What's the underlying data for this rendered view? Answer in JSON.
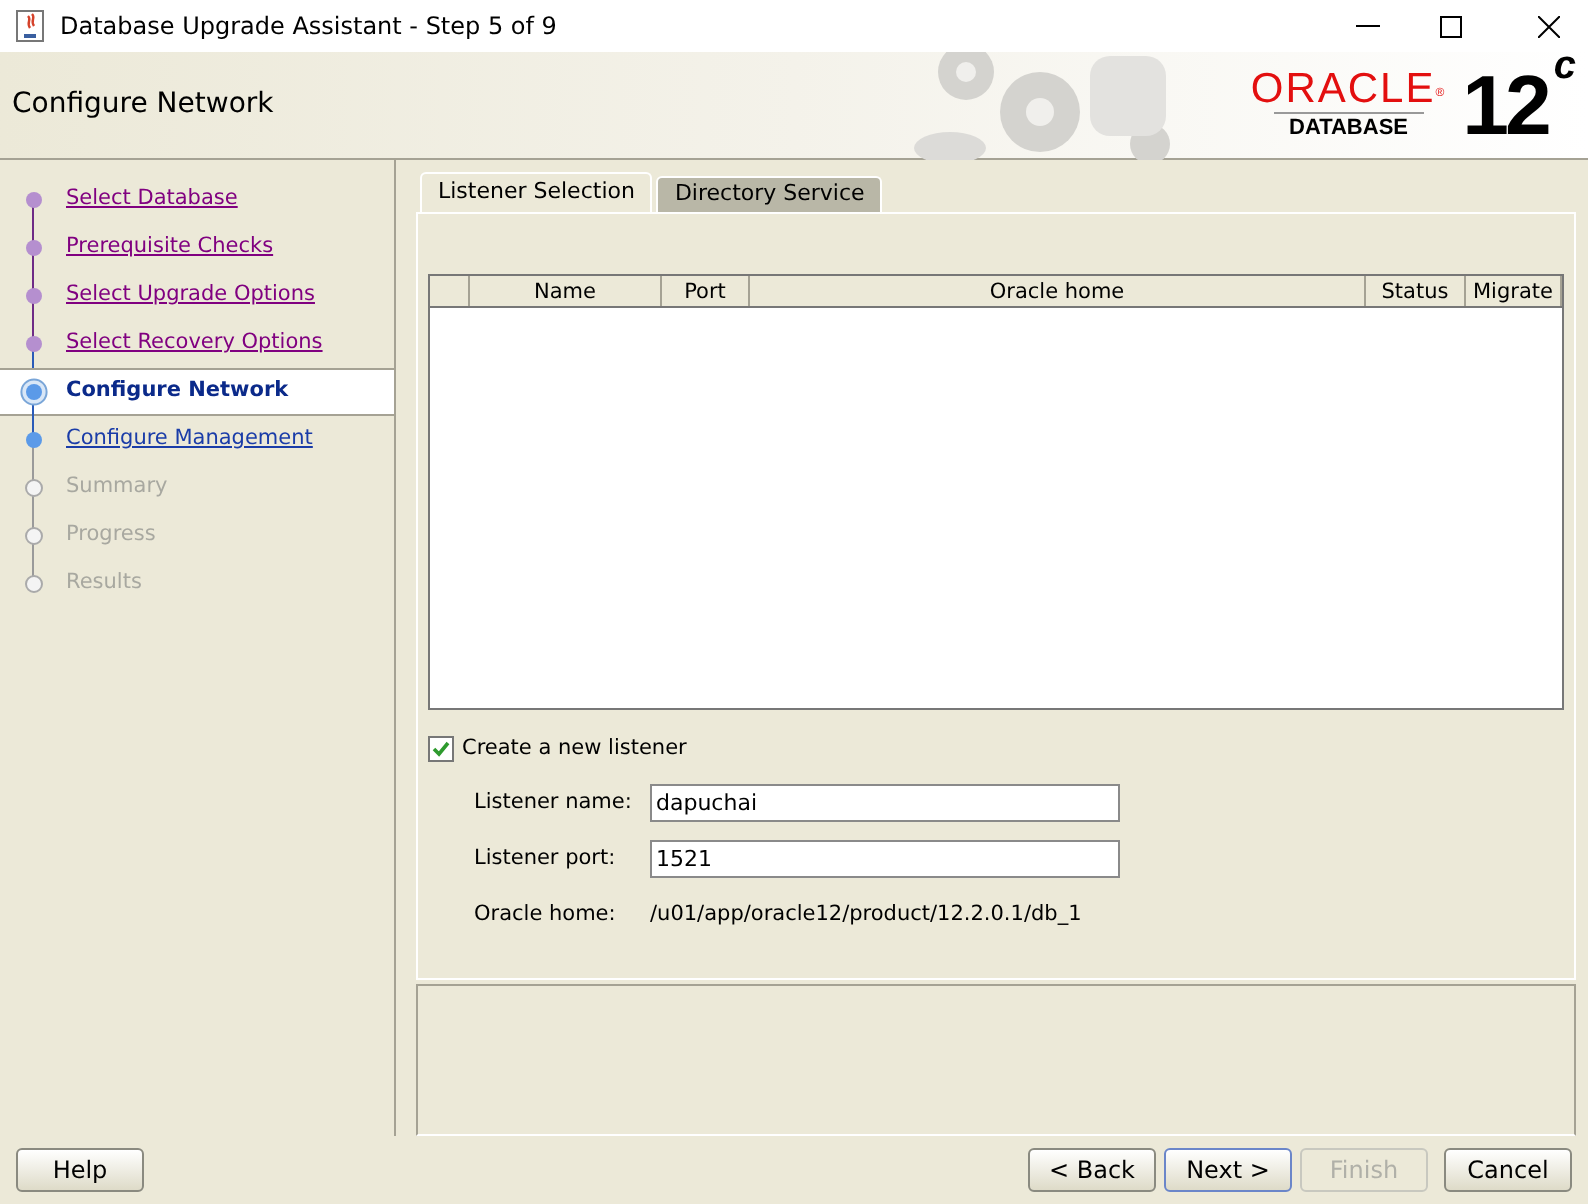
{
  "window": {
    "title": "Database Upgrade Assistant - Step 5 of 9"
  },
  "header": {
    "title": "Configure Network",
    "logo": {
      "brand": "ORACLE",
      "registered": "®",
      "product": "DATABASE",
      "version": "12",
      "version_sup": "c"
    }
  },
  "steps": [
    {
      "label": "Select Database",
      "kind": "done"
    },
    {
      "label": "Prerequisite Checks",
      "kind": "done"
    },
    {
      "label": "Select Upgrade Options",
      "kind": "done"
    },
    {
      "label": "Select Recovery Options",
      "kind": "done"
    },
    {
      "label": "Configure Network",
      "kind": "current"
    },
    {
      "label": "Configure Management",
      "kind": "next"
    },
    {
      "label": "Summary",
      "kind": "pending"
    },
    {
      "label": "Progress",
      "kind": "pending"
    },
    {
      "label": "Results",
      "kind": "pending"
    }
  ],
  "tabs": [
    {
      "label": "Listener Selection",
      "selected": true
    },
    {
      "label": "Directory Service",
      "selected": false
    }
  ],
  "table": {
    "columns": [
      "Name",
      "Port",
      "Oracle home",
      "Status",
      "Migrate"
    ]
  },
  "create_listener": {
    "label": "Create a new listener",
    "checked": true
  },
  "fields": [
    {
      "kind": "input",
      "label": "Listener name:",
      "value": "dapuchai"
    },
    {
      "kind": "input",
      "label": "Listener port:",
      "value": "1521"
    },
    {
      "kind": "text",
      "label": "Oracle home:",
      "value": "/u01/app/oracle12/product/12.2.0.1/db_1"
    }
  ],
  "buttons": [
    {
      "label": "Help",
      "disabled": false,
      "focused": false
    },
    {
      "label": "< Back",
      "disabled": false,
      "focused": false
    },
    {
      "label": "Next >",
      "disabled": false,
      "focused": true
    },
    {
      "label": "Finish",
      "disabled": true,
      "focused": false
    },
    {
      "label": "Cancel",
      "disabled": false,
      "focused": false
    }
  ]
}
